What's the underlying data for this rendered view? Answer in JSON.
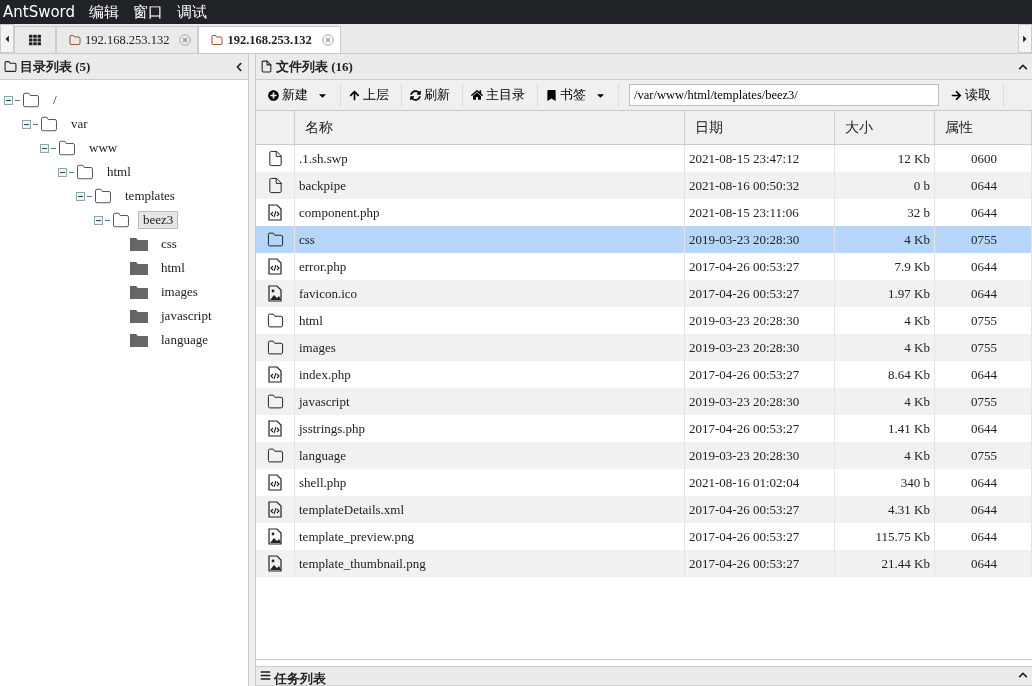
{
  "menubar": {
    "app": "AntSword",
    "items": [
      "编辑",
      "窗口",
      "调试"
    ]
  },
  "tabs": [
    {
      "kind": "home",
      "selected": false
    },
    {
      "kind": "host",
      "label": "192.168.253.132",
      "selected": false
    },
    {
      "kind": "host",
      "label": "192.168.253.132",
      "selected": true
    }
  ],
  "dir_panel": {
    "title": "目录列表 (5)",
    "tree": [
      {
        "label": "/",
        "expanded": true,
        "selected": false,
        "children": [
          {
            "label": "var",
            "expanded": true,
            "selected": false,
            "children": [
              {
                "label": "www",
                "expanded": true,
                "selected": false,
                "children": [
                  {
                    "label": "html",
                    "expanded": true,
                    "selected": false,
                    "children": [
                      {
                        "label": "templates",
                        "expanded": true,
                        "selected": false,
                        "children": [
                          {
                            "label": "beez3",
                            "expanded": true,
                            "selected": true,
                            "children": [
                              {
                                "label": "css",
                                "selected": false
                              },
                              {
                                "label": "html",
                                "selected": false
                              },
                              {
                                "label": "images",
                                "selected": false
                              },
                              {
                                "label": "javascript",
                                "selected": false
                              },
                              {
                                "label": "language",
                                "selected": false
                              }
                            ]
                          }
                        ]
                      }
                    ]
                  }
                ]
              }
            ]
          }
        ]
      }
    ]
  },
  "file_panel": {
    "title": "文件列表 (16)",
    "toolbar": [
      {
        "kind": "new",
        "label": "新建",
        "dropdown": true
      },
      {
        "kind": "up",
        "label": "上层",
        "dropdown": false
      },
      {
        "kind": "refresh",
        "label": "刷新",
        "dropdown": false
      },
      {
        "kind": "home",
        "label": "主目录",
        "dropdown": false
      },
      {
        "kind": "bookmark",
        "label": "书签",
        "dropdown": true
      }
    ],
    "path": "/var/www/html/templates/beez3/",
    "read_button": "读取",
    "columns": [
      "名称",
      "日期",
      "大小",
      "属性"
    ],
    "rows": [
      {
        "kind": "file",
        "name": ".1.sh.swp",
        "date": "2021-08-15 23:47:12",
        "size": "12 Kb",
        "mode": "0600",
        "selected": false
      },
      {
        "kind": "file",
        "name": "backpipe",
        "date": "2021-08-16 00:50:32",
        "size": "0 b",
        "mode": "0644",
        "selected": false
      },
      {
        "kind": "code",
        "name": "component.php",
        "date": "2021-08-15 23:11:06",
        "size": "32 b",
        "mode": "0644",
        "selected": false
      },
      {
        "kind": "folder",
        "name": "css",
        "date": "2019-03-23 20:28:30",
        "size": "4 Kb",
        "mode": "0755",
        "selected": true
      },
      {
        "kind": "code",
        "name": "error.php",
        "date": "2017-04-26 00:53:27",
        "size": "7.9 Kb",
        "mode": "0644",
        "selected": false
      },
      {
        "kind": "image",
        "name": "favicon.ico",
        "date": "2017-04-26 00:53:27",
        "size": "1.97 Kb",
        "mode": "0644",
        "selected": false
      },
      {
        "kind": "folder",
        "name": "html",
        "date": "2019-03-23 20:28:30",
        "size": "4 Kb",
        "mode": "0755",
        "selected": false
      },
      {
        "kind": "folder",
        "name": "images",
        "date": "2019-03-23 20:28:30",
        "size": "4 Kb",
        "mode": "0755",
        "selected": false
      },
      {
        "kind": "code",
        "name": "index.php",
        "date": "2017-04-26 00:53:27",
        "size": "8.64 Kb",
        "mode": "0644",
        "selected": false
      },
      {
        "kind": "folder",
        "name": "javascript",
        "date": "2019-03-23 20:28:30",
        "size": "4 Kb",
        "mode": "0755",
        "selected": false
      },
      {
        "kind": "code",
        "name": "jsstrings.php",
        "date": "2017-04-26 00:53:27",
        "size": "1.41 Kb",
        "mode": "0644",
        "selected": false
      },
      {
        "kind": "folder",
        "name": "language",
        "date": "2019-03-23 20:28:30",
        "size": "4 Kb",
        "mode": "0755",
        "selected": false
      },
      {
        "kind": "code",
        "name": "shell.php",
        "date": "2021-08-16 01:02:04",
        "size": "340 b",
        "mode": "0644",
        "selected": false
      },
      {
        "kind": "code",
        "name": "templateDetails.xml",
        "date": "2017-04-26 00:53:27",
        "size": "4.31 Kb",
        "mode": "0644",
        "selected": false
      },
      {
        "kind": "image",
        "name": "template_preview.png",
        "date": "2017-04-26 00:53:27",
        "size": "115.75 Kb",
        "mode": "0644",
        "selected": false
      },
      {
        "kind": "image",
        "name": "template_thumbnail.png",
        "date": "2017-04-26 00:53:27",
        "size": "21.44 Kb",
        "mode": "0644",
        "selected": false
      }
    ]
  },
  "task_panel": {
    "title": "任务列表"
  }
}
